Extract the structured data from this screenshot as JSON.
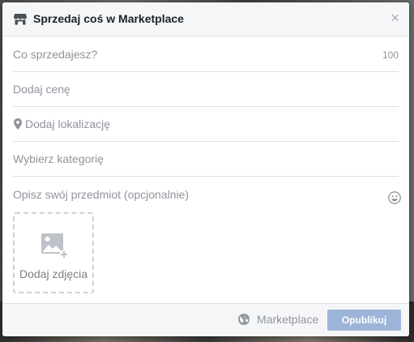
{
  "dialog": {
    "title": "Sprzedaj coś w Marketplace",
    "close_label": "×"
  },
  "form": {
    "title_placeholder": "Co sprzedajesz?",
    "title_counter": "100",
    "price_placeholder": "Dodaj cenę",
    "location_placeholder": "Dodaj lokalizację",
    "category_placeholder": "Wybierz kategorię",
    "description_placeholder": "Opisz swój przedmiot (opcjonalnie)",
    "add_photos_label": "Dodaj zdjęcia"
  },
  "footer": {
    "audience_label": "Marketplace",
    "publish_label": "Opublikuj"
  },
  "colors": {
    "accent_disabled": "#9cb4d8",
    "placeholder_text": "#90949c",
    "divider": "#dddfe2"
  },
  "icons": {
    "header": "storefront-icon",
    "close": "close-icon",
    "location": "map-pin-icon",
    "emoji": "emoji-icon",
    "photo": "add-photo-icon",
    "audience": "globe-icon"
  }
}
